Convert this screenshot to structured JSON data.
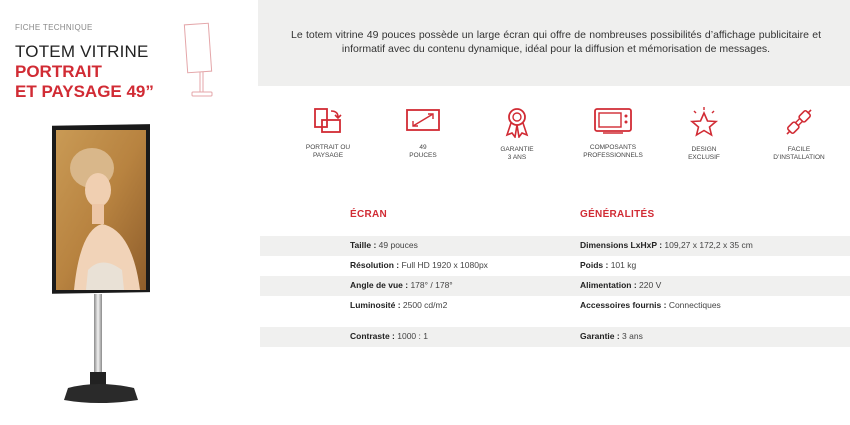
{
  "header": {
    "eyebrow": "FICHE TECHNIQUE",
    "title_line1": "TOTEM VITRINE",
    "title_line2": "PORTRAIT",
    "title_line3": "ET PAYSAGE 49”"
  },
  "description": "Le totem vitrine 49 pouces possède un large écran qui offre de nombreuses possibilités d’affichage publicitaire et informatif avec du contenu dynamique, idéal pour la diffusion et mémorisation de messages.",
  "features": [
    {
      "icon": "rotate-screen-icon",
      "label": "PORTRAIT OU\nPAYSAGE"
    },
    {
      "icon": "screen-diagonal-icon",
      "label": "49\nPOUCES"
    },
    {
      "icon": "award-ribbon-icon",
      "label": "GARANTIE\n3 ANS"
    },
    {
      "icon": "tv-components-icon",
      "label": "COMPOSANTS\nPROFESSIONNELS"
    },
    {
      "icon": "star-sparkle-icon",
      "label": "DESIGN\nEXCLUSIF"
    },
    {
      "icon": "plug-icon",
      "label": "FACILE\nD’INSTALLATION"
    }
  ],
  "sections": {
    "screen_title": "ÉCRAN",
    "general_title": "GÉNÉRALITÉS"
  },
  "specs": {
    "rows": [
      {
        "l_label": "Taille :",
        "l_value": " 49 pouces",
        "r_label": "Dimensions LxHxP :",
        "r_value": " 109,27 x 172,2 x 35 cm",
        "shade": true
      },
      {
        "l_label": "Résolution :",
        "l_value": " Full HD 1920 x 1080px",
        "r_label": "Poids :",
        "r_value": " 101 kg",
        "shade": false
      },
      {
        "l_label": "Angle de vue :",
        "l_value": " 178° / 178°",
        "r_label": "Alimentation :",
        "r_value": " 220 V",
        "shade": true
      },
      {
        "l_label": "Luminosité :",
        "l_value": " 2500 cd/m2",
        "r_label": "Accessoires fournis :",
        "r_value": " Connectiques",
        "shade": false
      },
      {
        "l_label": "Contraste :",
        "l_value": " 1000 : 1",
        "r_label": "Garantie :",
        "r_value": " 3 ans",
        "shade": true
      }
    ]
  },
  "colors": {
    "accent": "#d12b34",
    "panel": "#efefee"
  }
}
